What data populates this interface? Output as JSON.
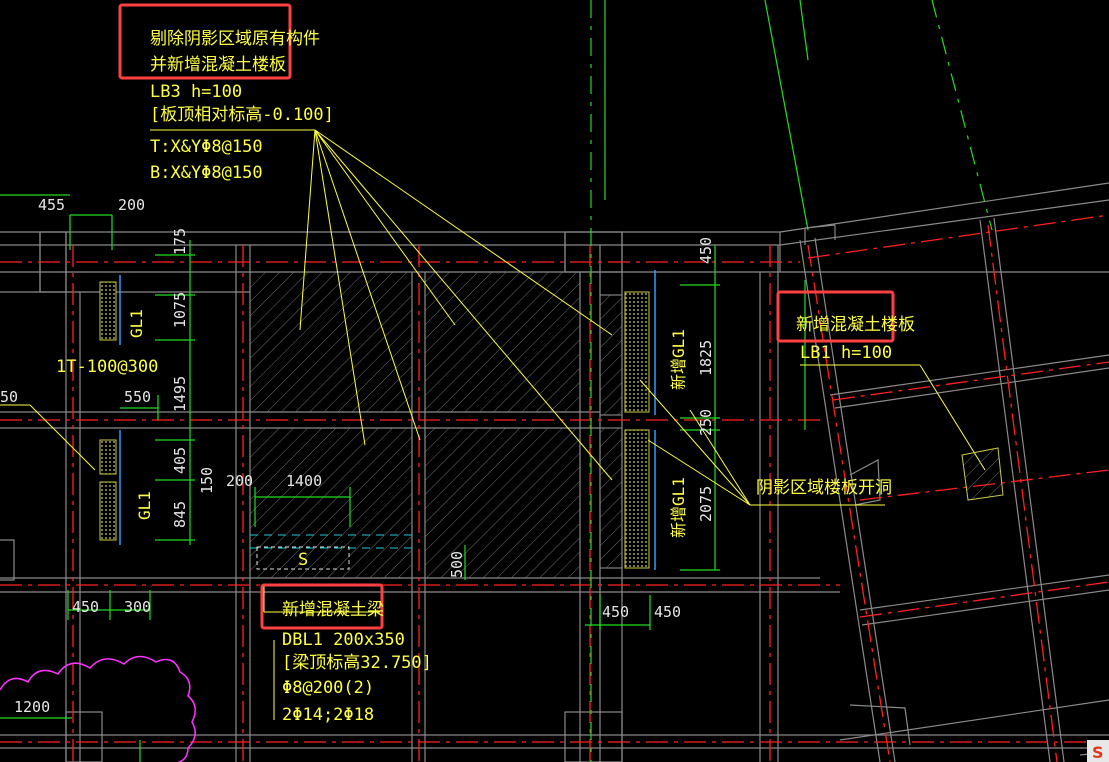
{
  "colors": {
    "background": "#000000",
    "wall": "#8a8a8a",
    "axis_red": "#ff2020",
    "axis_green": "#22dd22",
    "annotation": "#ffff44",
    "highlight_box": "#ff4040",
    "cloud": "#ff33ff",
    "hatch": "#7a7a7a",
    "blue_line": "#3399ff",
    "cyan_dash": "#22c8d8"
  },
  "notes": {
    "remove_line1": "剔除阴影区域原有构件",
    "remove_line2": "并新增混凝土楼板",
    "lb3_title": "LB3  h=100",
    "lb3_elev": "[板顶相对标高-0.100]",
    "lb3_top": "T:X&YΦ8@150",
    "lb3_bottom": "B:X&YΦ8@150",
    "new_slab": "新增混凝土楼板",
    "lb1_title": "LB1  h=100",
    "opening": "阴影区域楼板开洞",
    "new_beam": "新增混凝土梁",
    "dbl1_size": "DBL1  200x350",
    "dbl1_elev": "[梁顶标高32.750]",
    "dbl1_stirrup": "Φ8@200(2)",
    "dbl1_bars": "2Φ14;2Φ18",
    "rebar_1t": "1T-100@300",
    "s_label": "S"
  },
  "labels": {
    "gl1": "GL1",
    "new_gl1": "新增GL1"
  },
  "dimensions": {
    "d455": "455",
    "d200_top": "200",
    "d175": "175",
    "d1075": "1075",
    "d1495": "1495",
    "d550": "550",
    "d50": "50",
    "d405": "405",
    "d150": "150",
    "d845": "845",
    "d200_mid": "200",
    "d1400": "1400",
    "d500": "500",
    "d450_bl": "450",
    "d300": "300",
    "d1200": "1200",
    "d450_top": "450",
    "d1825": "1825",
    "d250": "250",
    "d2075": "2075",
    "d450_b1": "450",
    "d450_b2": "450"
  },
  "status_icon": "S"
}
